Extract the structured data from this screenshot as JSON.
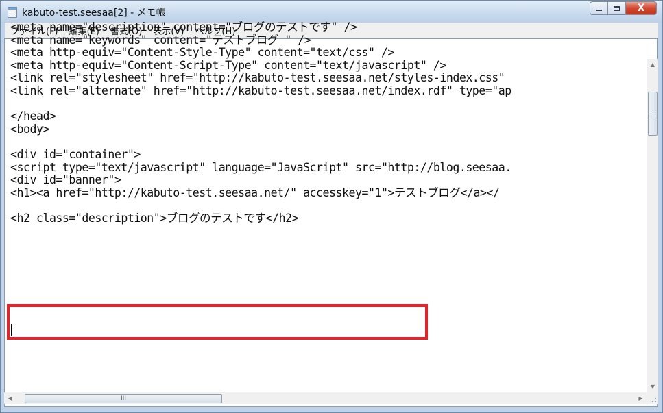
{
  "window": {
    "title": "kabuto-test.seesaa[2] - メモ帳",
    "icon": "notepad-icon"
  },
  "caption_buttons": {
    "minimize_icon": "minimize-icon",
    "maximize_icon": "maximize-icon",
    "close_label": "X"
  },
  "menu": [
    {
      "label": "ファイル(F)"
    },
    {
      "label": "編集(E)"
    },
    {
      "label": "書式(O)"
    },
    {
      "label": "表示(V)"
    },
    {
      "label": "ヘルプ(H)"
    }
  ],
  "editor": {
    "lines": [
      "<meta name=\"description\" content=\"ブログのテストです\" />",
      "<meta name=\"keywords\" content=\"テストブログ \" />",
      "<meta http-equiv=\"Content-Style-Type\" content=\"text/css\" />",
      "<meta http-equiv=\"Content-Script-Type\" content=\"text/javascript\" />",
      "<link rel=\"stylesheet\" href=\"http://kabuto-test.seesaa.net/styles-index.css\"",
      "<link rel=\"alternate\" href=\"http://kabuto-test.seesaa.net/index.rdf\" type=\"ap",
      "",
      "</head>",
      "<body>",
      "",
      "<div id=\"container\">",
      "<script type=\"text/javascript\" language=\"JavaScript\" src=\"http://blog.seesaa.",
      "<div id=\"banner\">",
      "<h1><a href=\"http://kabuto-test.seesaa.net/\" accesskey=\"1\">テストブログ</a></",
      "",
      "<h2 class=\"description\">ブログのテストです</h2>"
    ],
    "highlight_color": "#e0262a"
  },
  "scrollbars": {
    "up_arrow": "▲",
    "down_arrow": "▼",
    "left_arrow": "◀",
    "right_arrow": "▶",
    "hthumb_grip": "III"
  }
}
